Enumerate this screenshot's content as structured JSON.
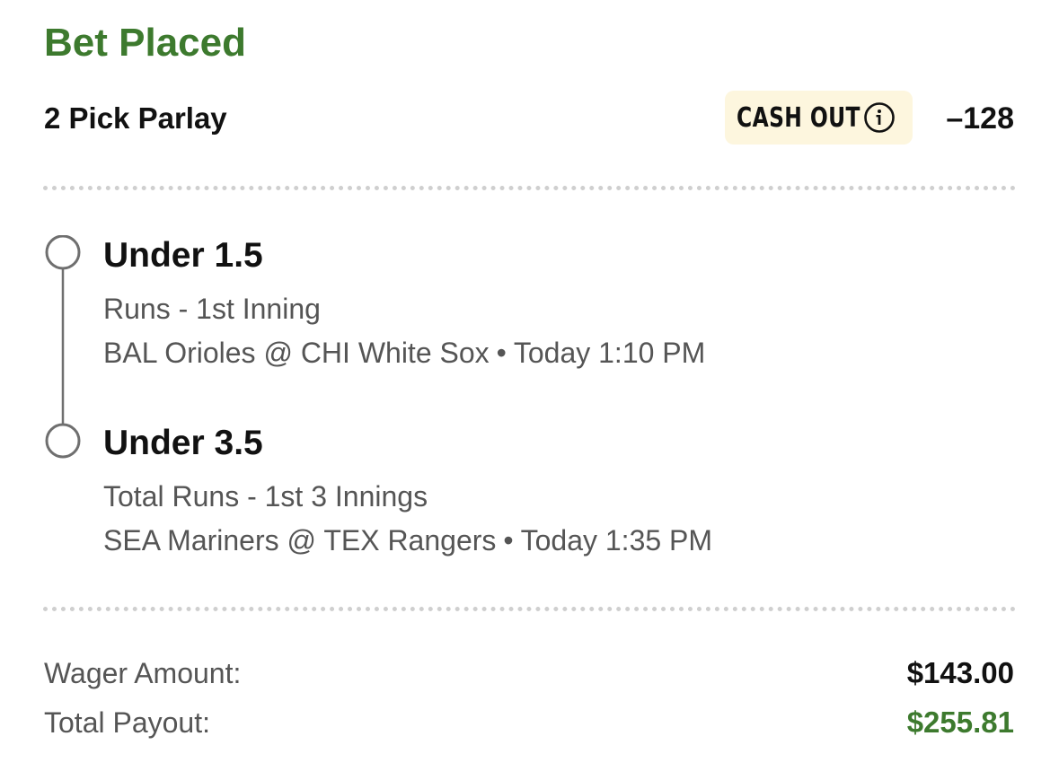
{
  "bet": {
    "status": "Bet Placed",
    "type": "2 Pick Parlay",
    "cash_out_label": "CASH OUT",
    "odds": "–128"
  },
  "legs": [
    {
      "title": "Under 1.5",
      "market": "Runs - 1st Inning",
      "matchup": "BAL Orioles @ CHI White Sox",
      "separator": "•",
      "time": "Today 1:10 PM"
    },
    {
      "title": "Under 3.5",
      "market": "Total Runs - 1st 3 Innings",
      "matchup": "SEA Mariners @ TEX Rangers",
      "separator": "•",
      "time": "Today 1:35 PM"
    }
  ],
  "summary": {
    "wager_label": "Wager Amount:",
    "wager_value": "$143.00",
    "payout_label": "Total Payout:",
    "payout_value": "$255.81"
  },
  "colors": {
    "status_green": "#3d7a2e",
    "cash_out_bg": "#fdf6de",
    "divider": "#cfcfcf",
    "secondary_text": "#555555"
  },
  "icons": [
    "info-icon",
    "leg-status-circle-icon"
  ]
}
